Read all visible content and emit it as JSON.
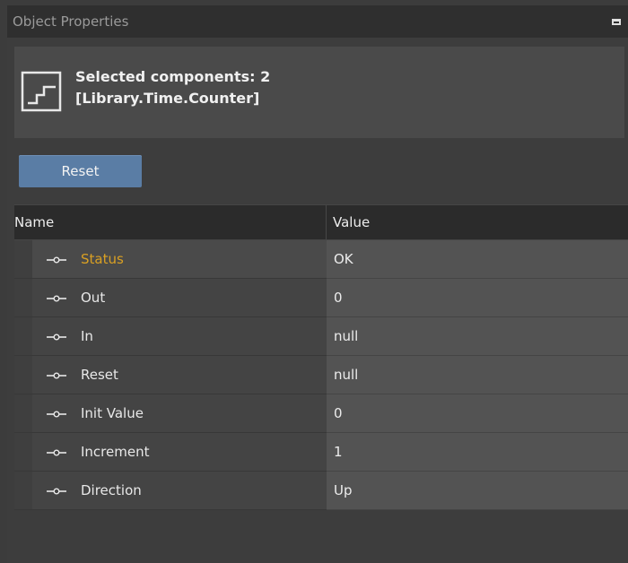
{
  "window": {
    "title": "Object Properties"
  },
  "header": {
    "selected_label": "Selected components: 2",
    "component_type": "[Library.Time.Counter]",
    "icon": "counter-step-icon"
  },
  "toolbar": {
    "reset_label": "Reset"
  },
  "grid": {
    "columns": {
      "name": "Name",
      "value": "Value"
    },
    "rows": [
      {
        "name": "Status",
        "value": "OK",
        "selected": true
      },
      {
        "name": "Out",
        "value": "0"
      },
      {
        "name": "In",
        "value": "null"
      },
      {
        "name": "Reset",
        "value": "null"
      },
      {
        "name": "Init Value",
        "value": "0"
      },
      {
        "name": "Increment",
        "value": "1"
      },
      {
        "name": "Direction",
        "value": "Up"
      }
    ]
  },
  "colors": {
    "accent_selected": "#d9a023",
    "button": "#5a7da5",
    "background": "#3c3c3c"
  }
}
